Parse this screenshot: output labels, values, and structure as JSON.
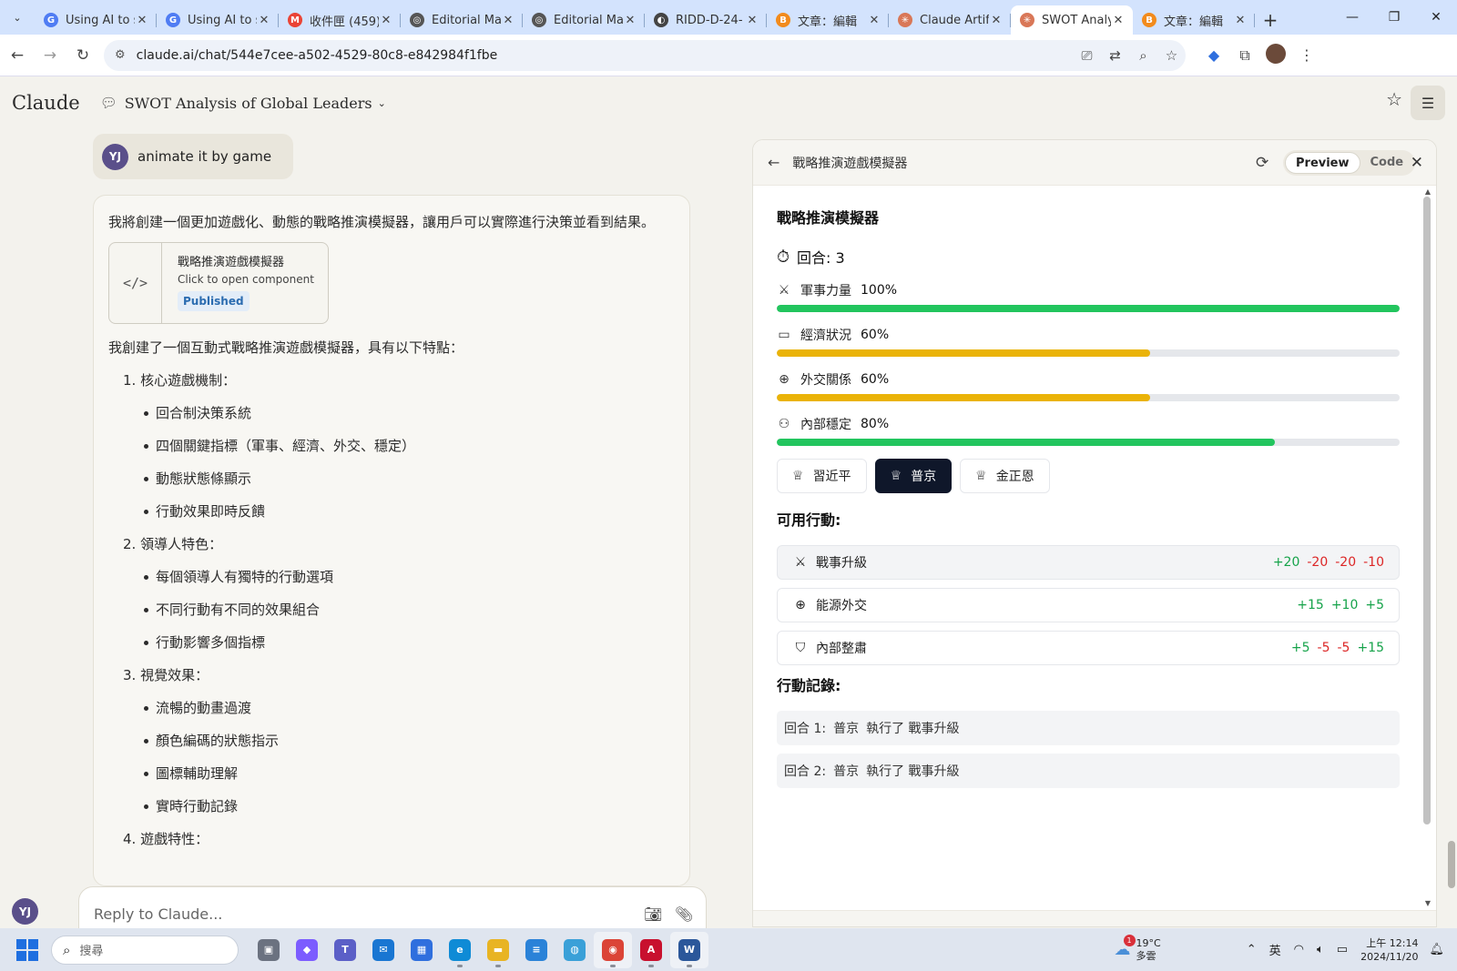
{
  "browser": {
    "tabs": [
      {
        "title": "Using AI to s",
        "fav_color": "#4f7cf3",
        "fav_glyph": "G"
      },
      {
        "title": "Using AI to s",
        "fav_color": "#4f7cf3",
        "fav_glyph": "G"
      },
      {
        "title": "收件匣 (459)",
        "fav_color": "#ea4335",
        "fav_glyph": "M"
      },
      {
        "title": "Editorial Ma",
        "fav_color": "#555555",
        "fav_glyph": "◎"
      },
      {
        "title": "Editorial Ma",
        "fav_color": "#555555",
        "fav_glyph": "◎"
      },
      {
        "title": "RIDD-D-24-",
        "fav_color": "#444444",
        "fav_glyph": "◐"
      },
      {
        "title": "文章：編輯",
        "fav_color": "#f28b1c",
        "fav_glyph": "B"
      },
      {
        "title": "Claude Artif",
        "fav_color": "#d97757",
        "fav_glyph": "✳"
      },
      {
        "title": "SWOT Analy",
        "fav_color": "#d97757",
        "fav_glyph": "✳",
        "active": true
      },
      {
        "title": "文章：編輯",
        "fav_color": "#f28b1c",
        "fav_glyph": "B"
      }
    ],
    "url": "claude.ai/chat/544e7cee-a502-4529-80c8-e842984f1fbe"
  },
  "header": {
    "logo": "Claude",
    "chat_title": "SWOT Analysis of Global Leaders"
  },
  "chat": {
    "user_initials": "YJ",
    "user_message": "animate it by game",
    "assistant_intro": "我將創建一個更加遊戲化、動態的戰略推演模擬器，讓用戶可以實際進行決策並看到結果。",
    "artifact": {
      "name": "戰略推演遊戲模擬器",
      "subtitle": "Click to open component",
      "badge": "Published"
    },
    "features_intro": "我創建了一個互動式戰略推演遊戲模擬器，具有以下特點：",
    "sections": [
      {
        "title": "1. 核心遊戲機制：",
        "items": [
          "回合制決策系統",
          "四個關鍵指標（軍事、經濟、外交、穩定）",
          "動態狀態條顯示",
          "行動效果即時反饋"
        ]
      },
      {
        "title": "2. 領導人特色：",
        "items": [
          "每個領導人有獨特的行動選項",
          "不同行動有不同的效果組合",
          "行動影響多個指標"
        ]
      },
      {
        "title": "3. 視覺效果：",
        "items": [
          "流暢的動畫過渡",
          "顏色編碼的狀態指示",
          "圖標輔助理解",
          "實時行動記錄"
        ]
      },
      {
        "title": "4. 遊戲特性：",
        "items": []
      }
    ],
    "reply_placeholder": "Reply to Claude..."
  },
  "panel": {
    "title": "戰略推演遊戲模擬器",
    "tab_preview": "Preview",
    "tab_code": "Code",
    "game": {
      "title": "戰略推演模擬器",
      "round_label": "回合: 3",
      "stats": [
        {
          "icon": "sword-icon",
          "glyph": "⚔",
          "label": "軍事力量",
          "value_text": "100%",
          "value": 100,
          "color": "#22c55e"
        },
        {
          "icon": "banknote-icon",
          "glyph": "▭",
          "label": "經濟狀況",
          "value_text": "60%",
          "value": 60,
          "color": "#eab308"
        },
        {
          "icon": "globe-icon",
          "glyph": "⊕",
          "label": "外交關係",
          "value_text": "60%",
          "value": 60,
          "color": "#eab308"
        },
        {
          "icon": "users-icon",
          "glyph": "⚇",
          "label": "內部穩定",
          "value_text": "80%",
          "value": 80,
          "color": "#22c55e"
        }
      ],
      "leaders": [
        {
          "name": "習近平",
          "selected": false
        },
        {
          "name": "普京",
          "selected": true
        },
        {
          "name": "金正恩",
          "selected": false
        }
      ],
      "actions_title": "可用行動:",
      "actions": [
        {
          "icon": "sword-icon",
          "glyph": "⚔",
          "name": "戰事升級",
          "effects": [
            "+20",
            "-20",
            "-20",
            "-10"
          ]
        },
        {
          "icon": "globe-icon",
          "glyph": "⊕",
          "name": "能源外交",
          "effects": [
            "+15",
            "+10",
            "+5"
          ]
        },
        {
          "icon": "shield-icon",
          "glyph": "⛉",
          "name": "內部整肅",
          "effects": [
            "+5",
            "-5",
            "-5",
            "+15"
          ]
        }
      ],
      "log_title": "行動記錄:",
      "log": [
        {
          "round": "回合 1:",
          "leader": "普京",
          "text": "執行了 戰事升級"
        },
        {
          "round": "回合 2:",
          "leader": "普京",
          "text": "執行了 戰事升級"
        }
      ]
    }
  },
  "taskbar": {
    "search_placeholder": "搜尋",
    "weather_temp": "19°C",
    "weather_desc": "多雲",
    "weather_badge": "1",
    "ime": "英",
    "time": "上午 12:14",
    "date": "2024/11/20",
    "apps": [
      {
        "name": "task-view",
        "color": "#6b7280",
        "glyph": "▣"
      },
      {
        "name": "copilot",
        "color": "#7c5cff",
        "glyph": "◆"
      },
      {
        "name": "teams",
        "color": "#5b5fc7",
        "glyph": "T"
      },
      {
        "name": "mail",
        "color": "#1976d2",
        "glyph": "✉"
      },
      {
        "name": "store",
        "color": "#2f6fde",
        "glyph": "▦"
      },
      {
        "name": "edge",
        "color": "#0f8bd6",
        "glyph": "e",
        "dot": true
      },
      {
        "name": "file-explorer",
        "color": "#e8b423",
        "glyph": "▬",
        "dot": true
      },
      {
        "name": "notepad",
        "color": "#2a82d8",
        "glyph": "≡"
      },
      {
        "name": "globe-app",
        "color": "#3aa0d8",
        "glyph": "◍"
      },
      {
        "name": "chrome",
        "color": "#db4437",
        "glyph": "◉",
        "active": true,
        "dot": true
      },
      {
        "name": "acrobat",
        "color": "#c8102e",
        "glyph": "A",
        "dot": true
      },
      {
        "name": "word",
        "color": "#2b579a",
        "glyph": "W",
        "active": true,
        "dot": true
      }
    ]
  }
}
